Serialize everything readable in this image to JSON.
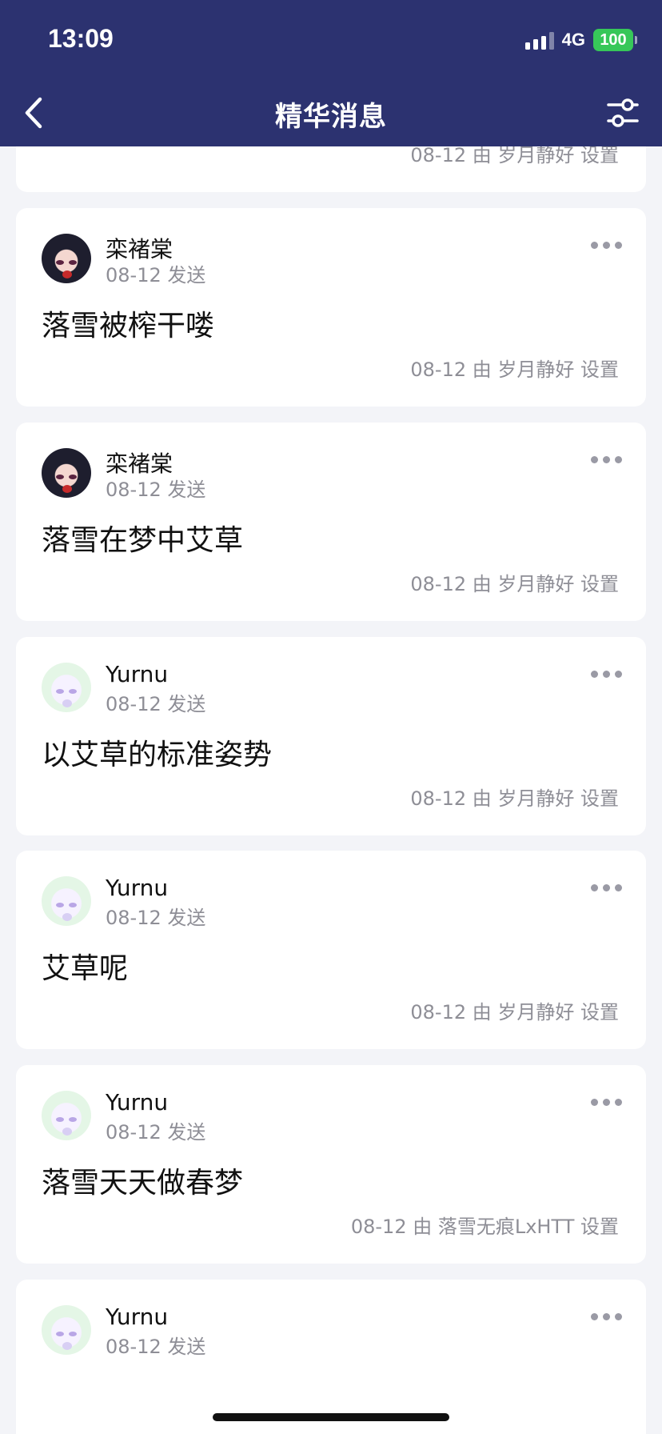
{
  "status_bar": {
    "time": "13:09",
    "network": "4G",
    "battery": "100"
  },
  "nav": {
    "title": "精华消息",
    "back_icon": "chevron-left-icon",
    "filter_icon": "sliders-icon"
  },
  "top_partial_footer": "08-12 由 岁月静好 设置",
  "posts": [
    {
      "name": "栾褚棠",
      "sent": "08-12 发送",
      "message": "落雪被榨干喽",
      "footer": "08-12 由 岁月静好 设置",
      "avatar": "dark"
    },
    {
      "name": "栾褚棠",
      "sent": "08-12 发送",
      "message": "落雪在梦中艾草",
      "footer": "08-12 由 岁月静好 设置",
      "avatar": "dark"
    },
    {
      "name": "Yurnu",
      "sent": "08-12 发送",
      "message": "以艾草的标准姿势",
      "footer": "08-12 由 岁月静好 设置",
      "avatar": "light"
    },
    {
      "name": "Yurnu",
      "sent": "08-12 发送",
      "message": "艾草呢",
      "footer": "08-12 由 岁月静好 设置",
      "avatar": "light"
    },
    {
      "name": "Yurnu",
      "sent": "08-12 发送",
      "message": "落雪天天做春梦",
      "footer": "08-12 由 落雪无痕LxHTT 设置",
      "avatar": "light"
    },
    {
      "name": "Yurnu",
      "sent": "08-12 发送",
      "message": "",
      "footer": "",
      "avatar": "light"
    }
  ]
}
